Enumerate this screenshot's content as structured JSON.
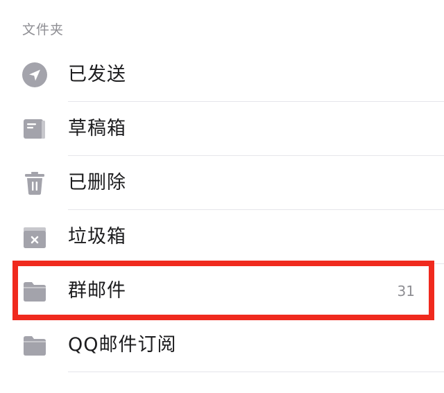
{
  "section": {
    "title": "文件夹"
  },
  "folders": [
    {
      "label": "已发送",
      "icon": "sent-icon",
      "count": ""
    },
    {
      "label": "草稿箱",
      "icon": "drafts-icon",
      "count": ""
    },
    {
      "label": "已删除",
      "icon": "trash-icon",
      "count": ""
    },
    {
      "label": "垃圾箱",
      "icon": "spam-icon",
      "count": ""
    },
    {
      "label": "群邮件",
      "icon": "folder-icon",
      "count": "31"
    },
    {
      "label": "QQ邮件订阅",
      "icon": "folder-icon",
      "count": ""
    }
  ],
  "colors": {
    "icon_gray": "#a3a3ab",
    "highlight": "#f02a1e",
    "text": "#1c1c1e",
    "secondary_text": "#8e8e93"
  }
}
